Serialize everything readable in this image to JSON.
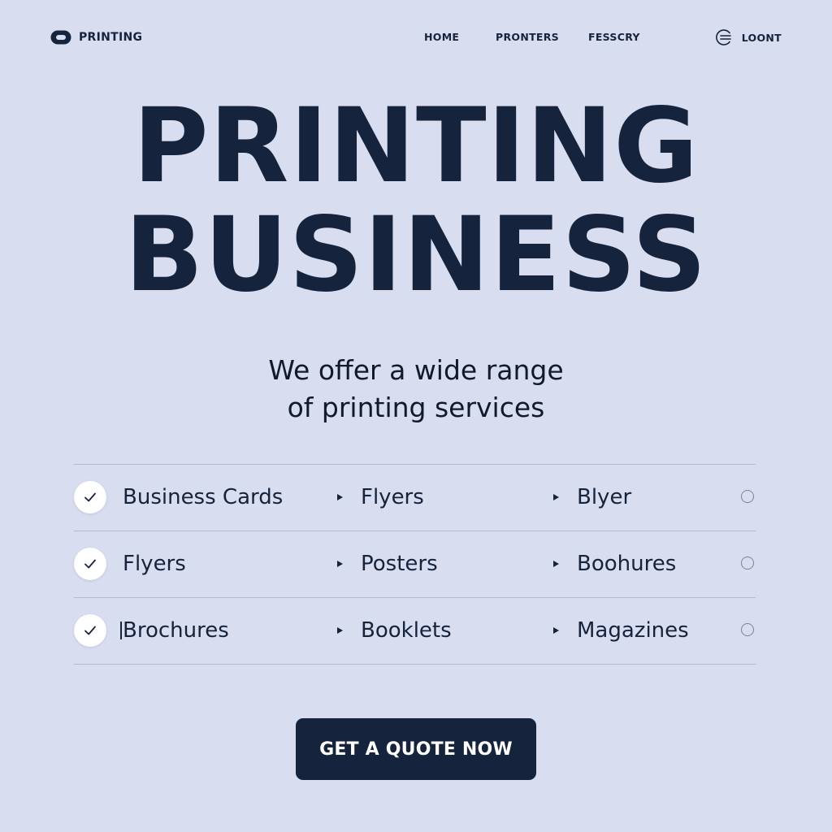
{
  "nav": {
    "brand": "PRINTING",
    "links": [
      "HOME",
      "PRONTERS",
      "FESSCRY"
    ],
    "login": "LOONT"
  },
  "hero": {
    "title_lines": [
      "PRINTING",
      "BUSINESS"
    ],
    "subtitle_lines": [
      "We offer a wide range",
      "of printing services"
    ]
  },
  "services": {
    "rows": [
      [
        "Business Cards",
        "Flyers",
        "Blyer"
      ],
      [
        "Flyers",
        "Posters",
        "Boohures"
      ],
      [
        "Brochures",
        "Booklets",
        "Magazines"
      ]
    ],
    "checked": [
      true,
      true,
      true
    ],
    "selected_radio": [
      false,
      false,
      false
    ]
  },
  "cta": {
    "label": "GET A QUOTE NOW"
  },
  "colors": {
    "background": "#d9ddf0",
    "primary": "#15233d",
    "divider": "#b3b9cf",
    "check_bg": "#ffffff"
  },
  "icons": {
    "brand": "pill-logo-icon",
    "login": "login-icon",
    "check": "check-icon",
    "caret": "caret-right-icon",
    "radio": "radio-icon"
  }
}
